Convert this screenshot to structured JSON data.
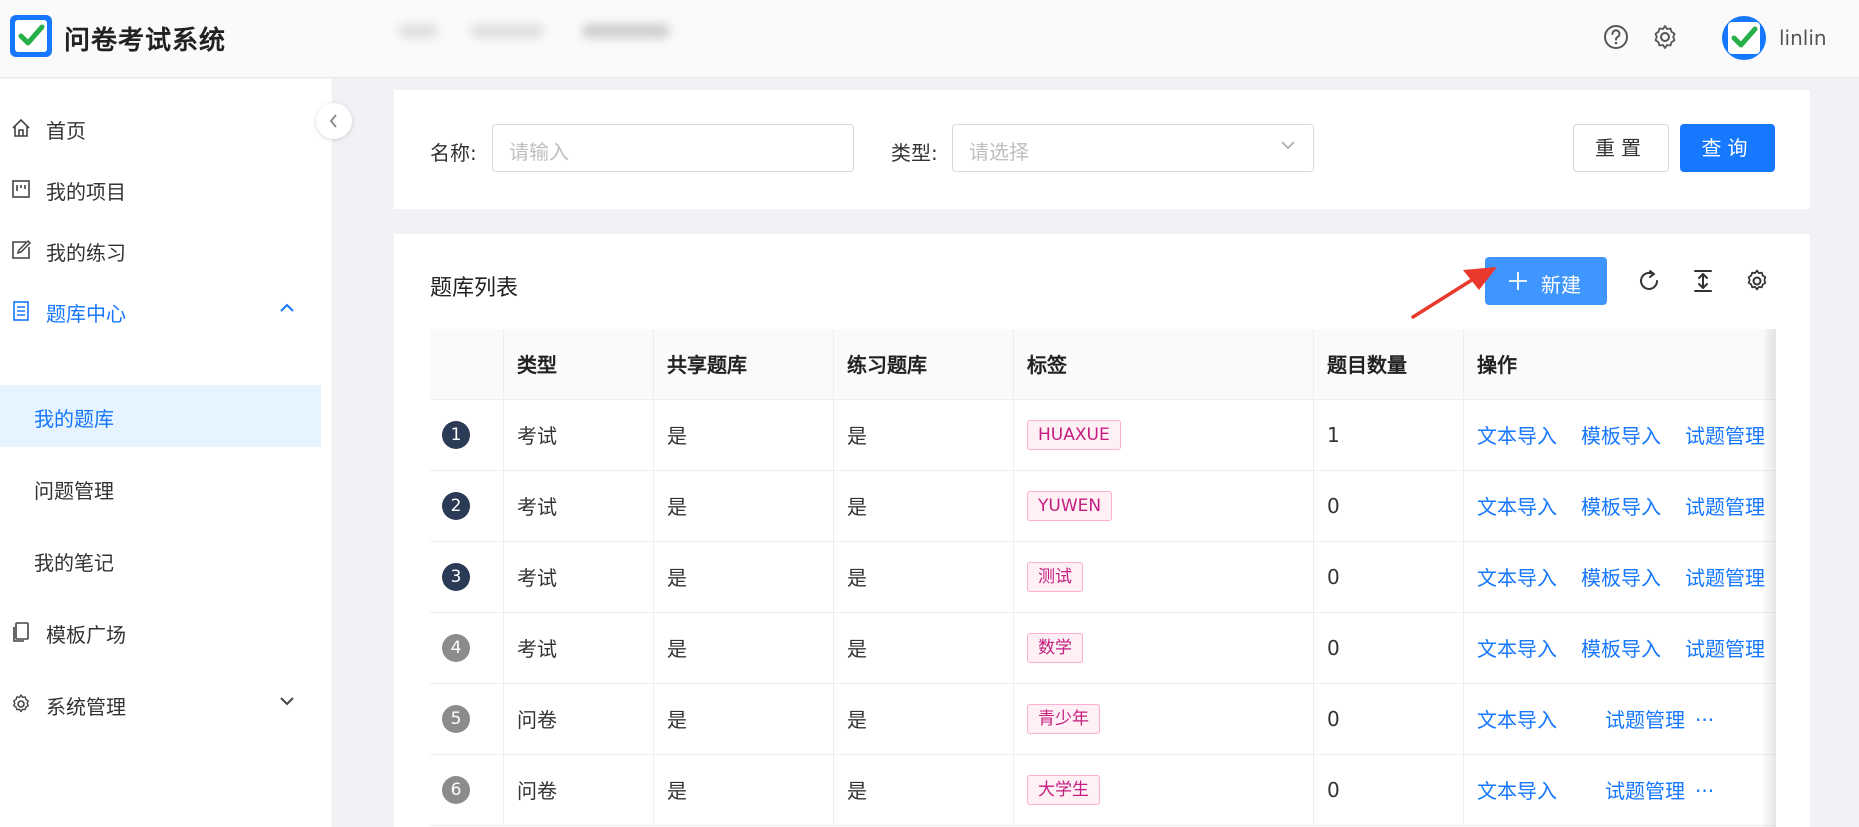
{
  "header": {
    "app_title": "问卷考试系统",
    "user_name": "linlin"
  },
  "sidebar": {
    "items": [
      {
        "label": "首页",
        "icon": "home-icon"
      },
      {
        "label": "我的项目",
        "icon": "project-icon"
      },
      {
        "label": "我的练习",
        "icon": "edit-icon"
      },
      {
        "label": "题库中心",
        "icon": "question-bank-icon",
        "expanded": true
      },
      {
        "label": "我的题库",
        "selected": true
      },
      {
        "label": "问题管理"
      },
      {
        "label": "我的笔记"
      },
      {
        "label": "模板广场",
        "icon": "template-icon"
      },
      {
        "label": "系统管理",
        "icon": "gear-icon"
      }
    ]
  },
  "search": {
    "name_label": "名称:",
    "name_placeholder": "请输入",
    "type_label": "类型:",
    "type_placeholder": "请选择",
    "reset_label": "重置",
    "query_label": "查询"
  },
  "table_card": {
    "title": "题库列表",
    "new_label": "新建",
    "columns": [
      "",
      "类型",
      "共享题库",
      "练习题库",
      "标签",
      "题目数量",
      "操作"
    ],
    "rows": [
      {
        "index": "1",
        "type": "考试",
        "shared": "是",
        "practice": "是",
        "tag": "HUAXUE",
        "count": "1",
        "ops": [
          "文本导入",
          "模板导入",
          "试题管理"
        ]
      },
      {
        "index": "2",
        "type": "考试",
        "shared": "是",
        "practice": "是",
        "tag": "YUWEN",
        "count": "0",
        "ops": [
          "文本导入",
          "模板导入",
          "试题管理"
        ]
      },
      {
        "index": "3",
        "type": "考试",
        "shared": "是",
        "practice": "是",
        "tag": "测试",
        "count": "0",
        "ops": [
          "文本导入",
          "模板导入",
          "试题管理"
        ]
      },
      {
        "index": "4",
        "type": "考试",
        "shared": "是",
        "practice": "是",
        "tag": "数学",
        "count": "0",
        "ops": [
          "文本导入",
          "模板导入",
          "试题管理"
        ]
      },
      {
        "index": "5",
        "type": "问卷",
        "shared": "是",
        "practice": "是",
        "tag": "青少年",
        "count": "0",
        "ops": [
          "文本导入",
          "试题管理"
        ],
        "more": "···"
      },
      {
        "index": "6",
        "type": "问卷",
        "shared": "是",
        "practice": "是",
        "tag": "大学生",
        "count": "0",
        "ops": [
          "文本导入",
          "试题管理"
        ],
        "more": "···"
      }
    ]
  },
  "colors": {
    "primary": "#1677ff",
    "index_dark": "#2b3a55",
    "index_grey": "#8c8c8c",
    "tag_text": "#c41d7f",
    "annotation_arrow": "#e8392c"
  }
}
